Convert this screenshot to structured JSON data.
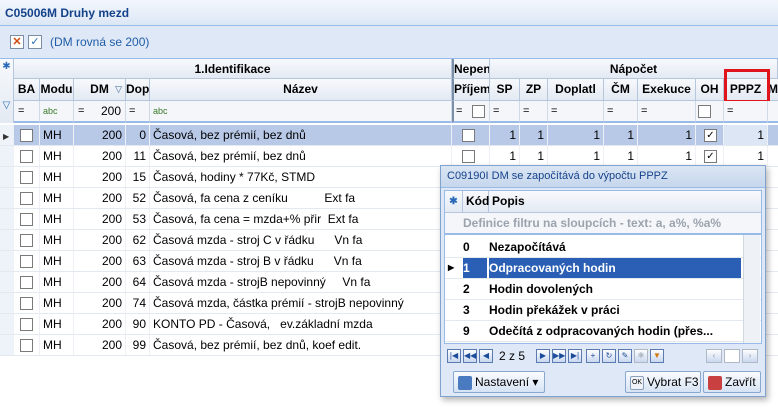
{
  "window": {
    "title": "C05006M Druhy mezd"
  },
  "filter": {
    "text": "(DM rovná se 200)",
    "clear_icon": "close-x-icon",
    "check_icon": "check-icon"
  },
  "grid": {
    "group_headers": {
      "ident": "1.Identifikace",
      "nezapocet": "Nepen",
      "napocet": "Nápočet"
    },
    "columns": {
      "ba": "BA",
      "modul": "Modu",
      "dm": "DM",
      "dop": "Dop",
      "nazev": "Název",
      "prijem": "Příjem",
      "sp": "SP",
      "zp": "ZP",
      "doplat": "Doplatl",
      "cm": "ČM",
      "exekuce": "Exekuce",
      "oh": "OH",
      "pppz": "PPPZ",
      "m": "M"
    },
    "filter_row": {
      "eq": "=",
      "abc": "abc",
      "dm_value": "200"
    },
    "rows": [
      {
        "modul": "MH",
        "dm": "200",
        "dop": "0",
        "nazev": "Časová, bez prémií, bez dnů",
        "sp": "1",
        "zp": "1",
        "doplat": "1",
        "cm": "1",
        "exekuce": "1",
        "oh_checked": true,
        "pppz": "1",
        "selected": true,
        "has_values": true
      },
      {
        "modul": "MH",
        "dm": "200",
        "dop": "11",
        "nazev": "Časová, bez prémií, bez dnů",
        "sp": "1",
        "zp": "1",
        "doplat": "1",
        "cm": "1",
        "exekuce": "1",
        "oh_checked": true,
        "pppz": "1",
        "selected": false,
        "has_values": true
      },
      {
        "modul": "MH",
        "dm": "200",
        "dop": "15",
        "nazev": "Časová, hodiny * 77Kč, STMD"
      },
      {
        "modul": "MH",
        "dm": "200",
        "dop": "52",
        "nazev": "Časová, fa cena z ceníku           Ext fa"
      },
      {
        "modul": "MH",
        "dm": "200",
        "dop": "53",
        "nazev": "Časová, fa cena = mzda+% přir  Ext fa"
      },
      {
        "modul": "MH",
        "dm": "200",
        "dop": "62",
        "nazev": "Časová mzda - stroj C v řádku      Vn fa"
      },
      {
        "modul": "MH",
        "dm": "200",
        "dop": "63",
        "nazev": "Časová mzda - stroj B v řádku      Vn fa"
      },
      {
        "modul": "MH",
        "dm": "200",
        "dop": "64",
        "nazev": "Časová mzda - strojB nepovinný     Vn fa"
      },
      {
        "modul": "MH",
        "dm": "200",
        "dop": "74",
        "nazev": "Časová mzda, částka prémií - strojB nepovinný"
      },
      {
        "modul": "MH",
        "dm": "200",
        "dop": "90",
        "nazev": "KONTO PD - Časová,   ev.základní mzda"
      },
      {
        "modul": "MH",
        "dm": "200",
        "dop": "99",
        "nazev": "Časová, bez prémií, bez dnů, koef edit."
      }
    ]
  },
  "popup": {
    "title": "C09190I DM se započítává do výpočtu PPPZ",
    "columns": {
      "kod": "Kód",
      "popis": "Popis"
    },
    "filter_placeholder": "Definice filtru na sloupcích - text: a, a%, %a%",
    "rows": [
      {
        "kod": "0",
        "popis": "Nezapočítává",
        "selected": false
      },
      {
        "kod": "1",
        "popis": "Odpracovaných hodin",
        "selected": true
      },
      {
        "kod": "2",
        "popis": "Hodin dovolených",
        "selected": false
      },
      {
        "kod": "3",
        "popis": "Hodin překážek v práci",
        "selected": false
      },
      {
        "kod": "9",
        "popis": "Odečítá z odpracovaných hodin (přes...",
        "selected": false
      }
    ],
    "pager": "2 z 5",
    "buttons": {
      "settings": "Nastavení",
      "select": "Vybrat F3",
      "close": "Zavřít"
    }
  }
}
